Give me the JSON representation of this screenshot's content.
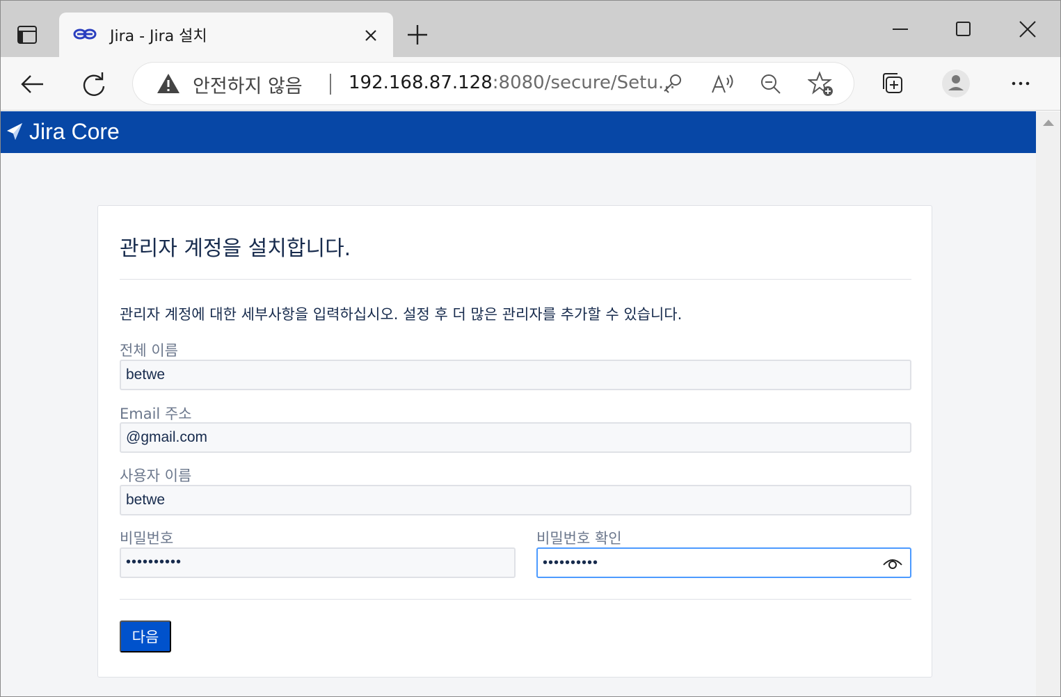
{
  "browser": {
    "tab": {
      "title": "Jira - Jira 설치"
    },
    "address": {
      "security_warning": "안전하지 않음",
      "url_host": "192.168.87.128",
      "url_rest": ":8080/secure/Setu..."
    },
    "icons": [
      "sidebar-icon",
      "jira-tab-favicon",
      "close-icon",
      "plus-icon",
      "minimize-icon",
      "maximize-icon",
      "close-icon",
      "back-arrow-icon",
      "refresh-icon",
      "warning-icon",
      "key-icon",
      "read-aloud-icon",
      "zoom-out-icon",
      "add-favorite-icon",
      "collections-icon",
      "profile-icon",
      "more-icon"
    ]
  },
  "app": {
    "brand": "Jira Core",
    "header_color": "#0747a6"
  },
  "form": {
    "title": "관리자 계정을 설치합니다.",
    "description": "관리자 계정에 대한 세부사항을 입력하십시오. 설정 후 더 많은 관리자를 추가할 수 있습니다.",
    "fields": {
      "full_name": {
        "label": "전체 이름",
        "value": "betwe"
      },
      "email": {
        "label": "Email 주소",
        "value": "@gmail.com"
      },
      "username": {
        "label": "사용자 이름",
        "value": "betwe"
      },
      "password": {
        "label": "비밀번호",
        "value": "••••••••••"
      },
      "password_confirm": {
        "label": "비밀번호 확인",
        "value": "••••••••••"
      }
    },
    "submit_label": "다음",
    "accent_color": "#0052cc",
    "focus_color": "#4c9aff"
  }
}
